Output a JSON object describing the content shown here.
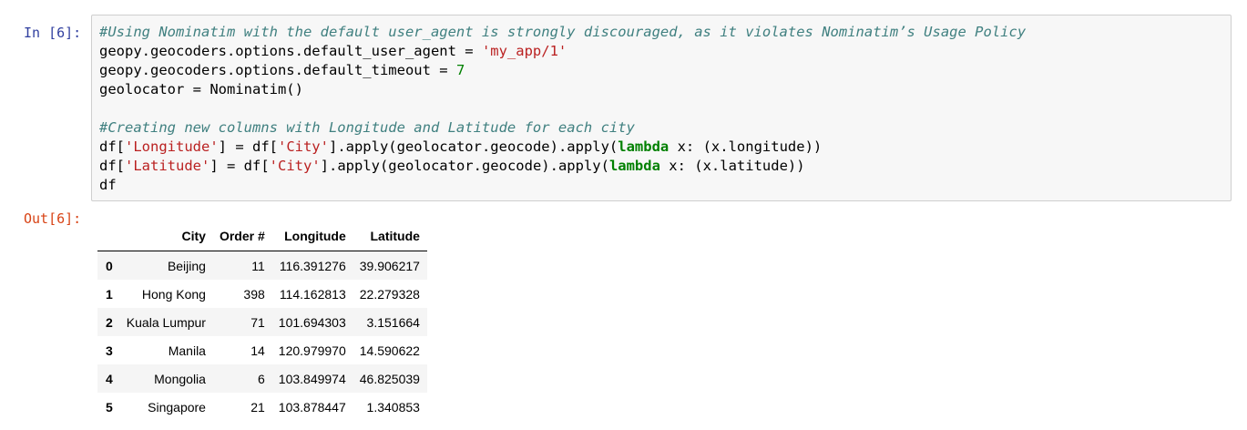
{
  "input_cell": {
    "prompt": "In [6]:",
    "lines": [
      [
        {
          "cls": "tok-comment",
          "text": "#Using Nominatim with the default user_agent is strongly discouraged, as it violates Nominatim’s Usage Policy"
        }
      ],
      [
        {
          "cls": "tok-plain",
          "text": "geopy.geocoders.options.default_user_agent = "
        },
        {
          "cls": "tok-string",
          "text": "'my_app/1'"
        }
      ],
      [
        {
          "cls": "tok-plain",
          "text": "geopy.geocoders.options.default_timeout = "
        },
        {
          "cls": "tok-number",
          "text": "7"
        }
      ],
      [
        {
          "cls": "tok-plain",
          "text": "geolocator = Nominatim()"
        }
      ],
      [
        {
          "cls": "tok-plain",
          "text": ""
        }
      ],
      [
        {
          "cls": "tok-comment",
          "text": "#Creating new columns with Longitude and Latitude for each city"
        }
      ],
      [
        {
          "cls": "tok-plain",
          "text": "df["
        },
        {
          "cls": "tok-string",
          "text": "'Longitude'"
        },
        {
          "cls": "tok-plain",
          "text": "] = df["
        },
        {
          "cls": "tok-string",
          "text": "'City'"
        },
        {
          "cls": "tok-plain",
          "text": "].apply(geolocator.geocode).apply("
        },
        {
          "cls": "tok-keyword",
          "text": "lambda"
        },
        {
          "cls": "tok-plain",
          "text": " x: (x.longitude))"
        }
      ],
      [
        {
          "cls": "tok-plain",
          "text": "df["
        },
        {
          "cls": "tok-string",
          "text": "'Latitude'"
        },
        {
          "cls": "tok-plain",
          "text": "] = df["
        },
        {
          "cls": "tok-string",
          "text": "'City'"
        },
        {
          "cls": "tok-plain",
          "text": "].apply(geolocator.geocode).apply("
        },
        {
          "cls": "tok-keyword",
          "text": "lambda"
        },
        {
          "cls": "tok-plain",
          "text": " x: (x.latitude))"
        }
      ],
      [
        {
          "cls": "tok-plain",
          "text": "df"
        }
      ]
    ]
  },
  "output_cell": {
    "prompt": "Out[6]:",
    "table": {
      "index_header": "",
      "columns": [
        "City",
        "Order #",
        "Longitude",
        "Latitude"
      ],
      "rows": [
        {
          "index": "0",
          "values": [
            "Beijing",
            "11",
            "116.391276",
            "39.906217"
          ]
        },
        {
          "index": "1",
          "values": [
            "Hong Kong",
            "398",
            "114.162813",
            "22.279328"
          ]
        },
        {
          "index": "2",
          "values": [
            "Kuala Lumpur",
            "71",
            "101.694303",
            "3.151664"
          ]
        },
        {
          "index": "3",
          "values": [
            "Manila",
            "14",
            "120.979970",
            "14.590622"
          ]
        },
        {
          "index": "4",
          "values": [
            "Mongolia",
            "6",
            "103.849974",
            "46.825039"
          ]
        },
        {
          "index": "5",
          "values": [
            "Singapore",
            "21",
            "103.878447",
            "1.340853"
          ]
        }
      ]
    }
  },
  "colors": {
    "in_prompt": "#303f9f",
    "out_prompt": "#d84315",
    "comment": "#408080",
    "string": "#ba2121",
    "number": "#008000",
    "keyword": "#008000",
    "input_background": "#f7f7f7",
    "input_border": "#cfcfcf"
  }
}
